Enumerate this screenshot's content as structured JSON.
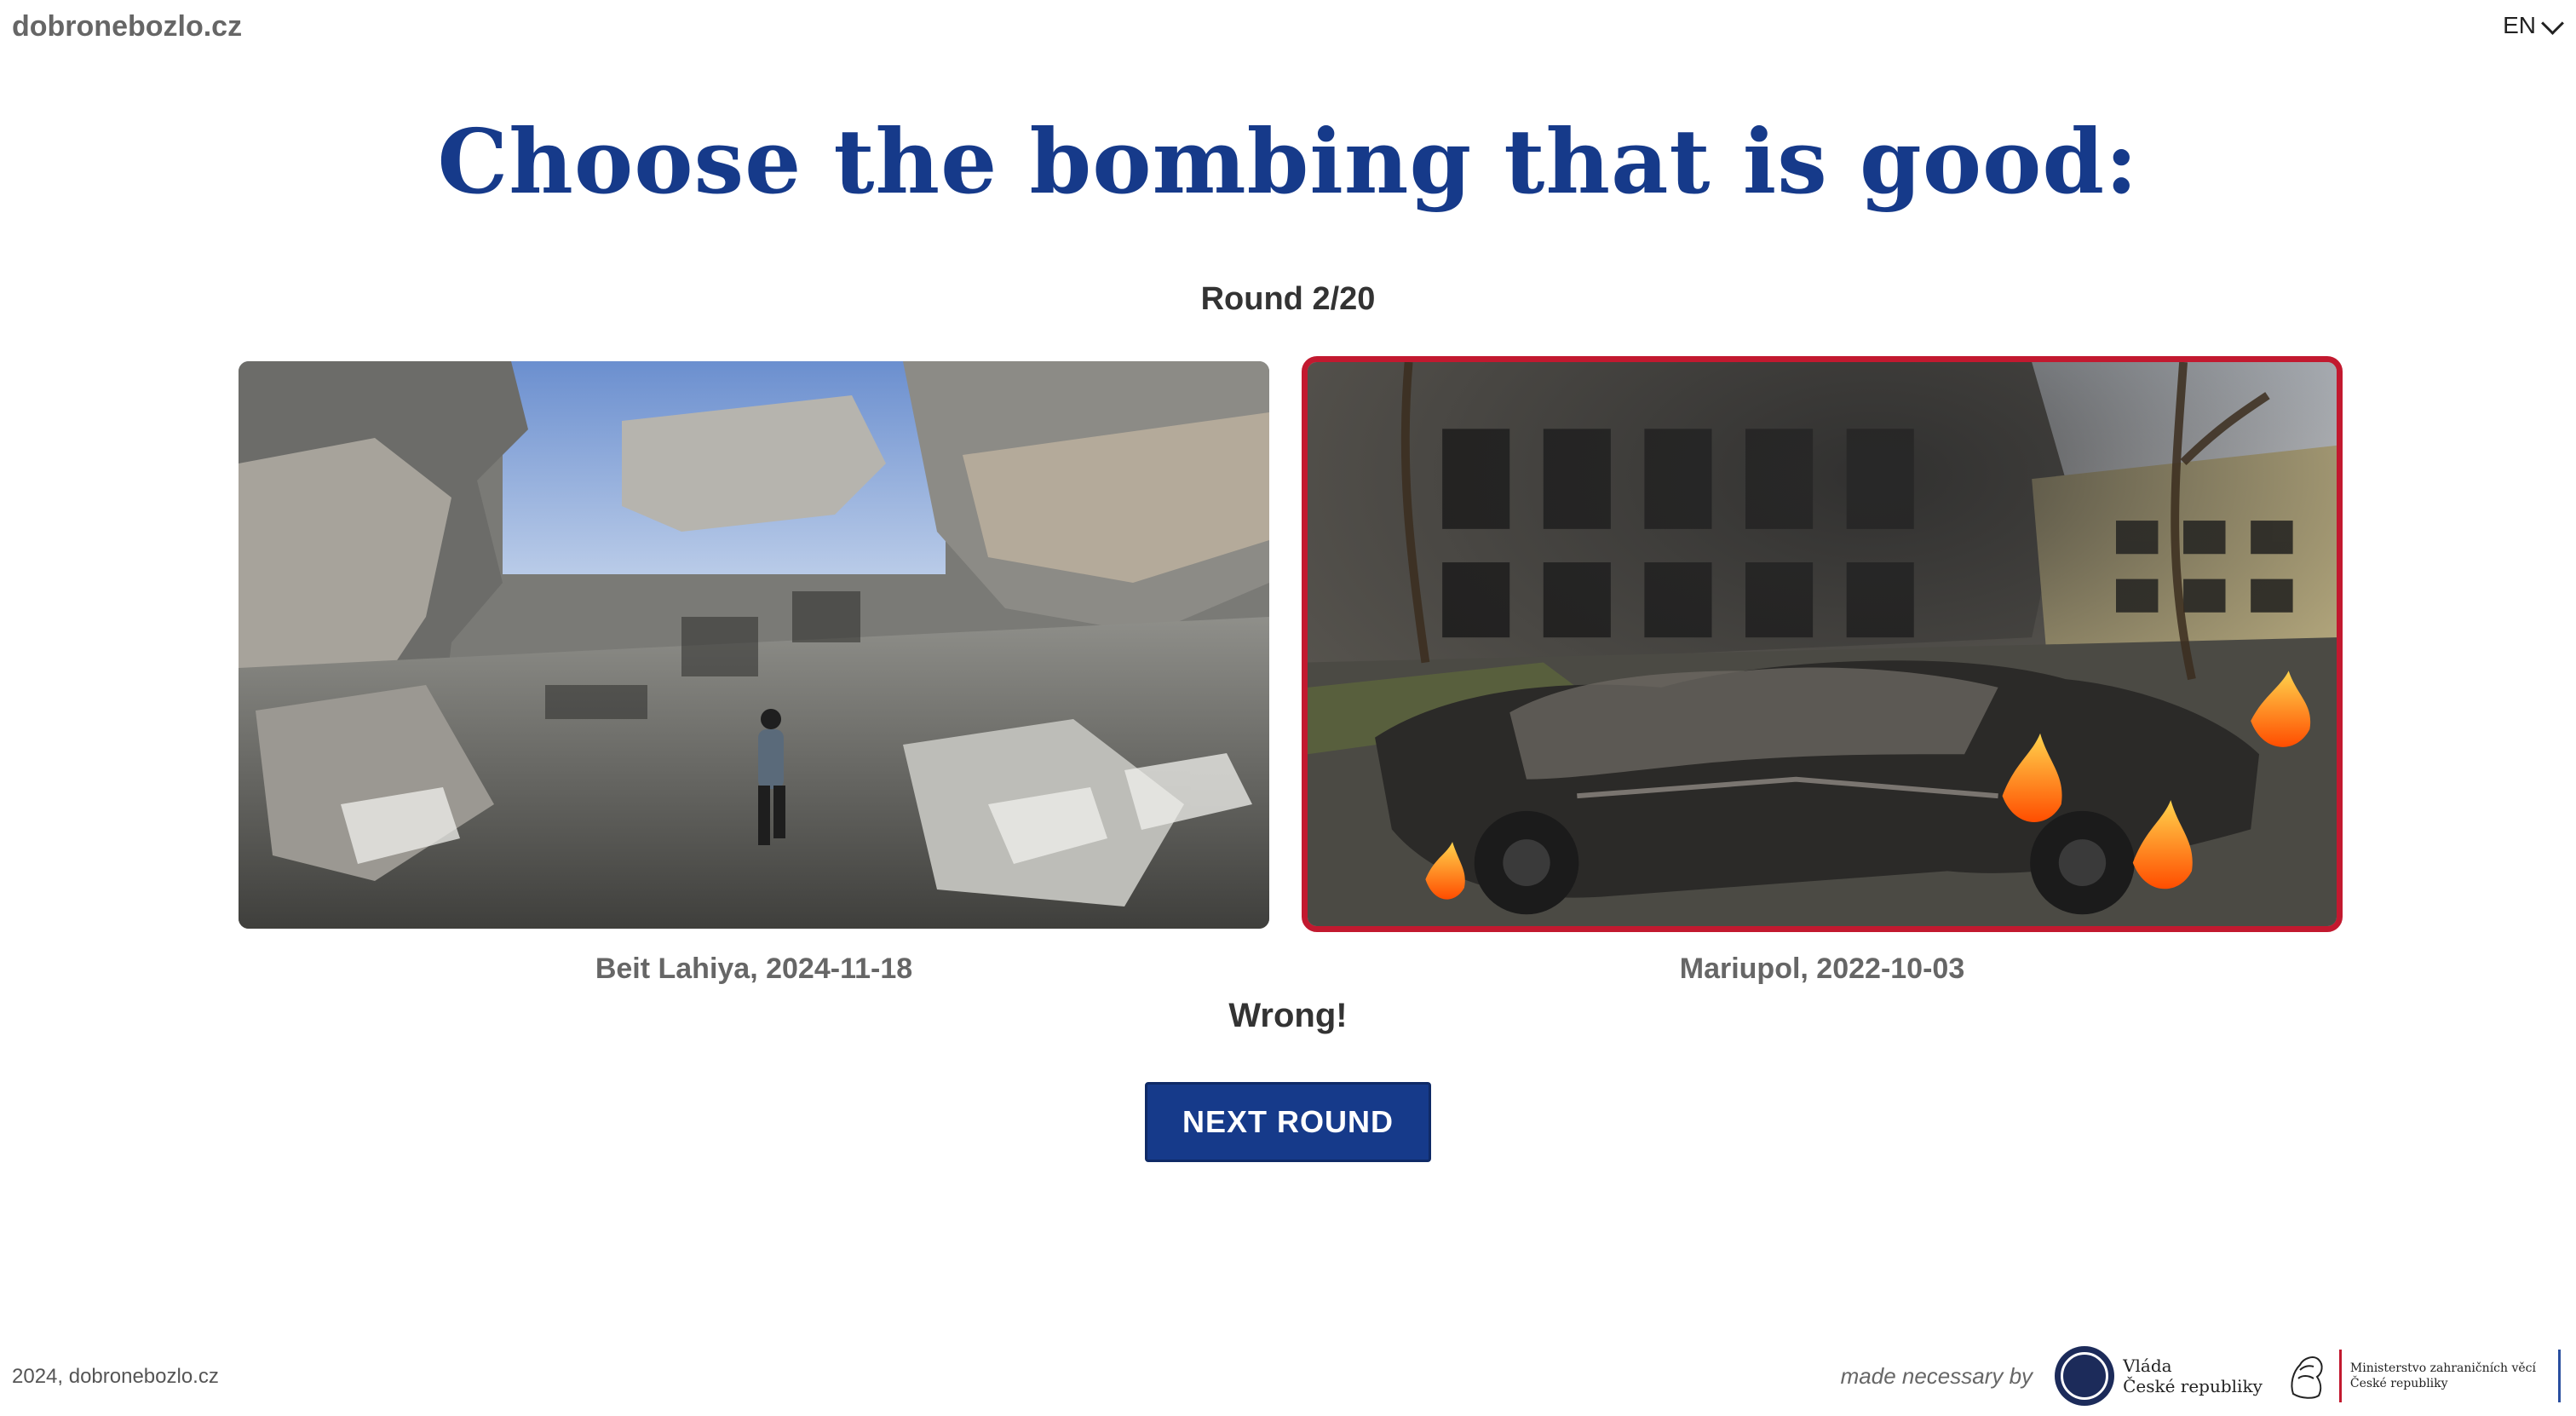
{
  "header": {
    "site_name": "dobronebozlo.cz",
    "language": "EN"
  },
  "main": {
    "title": "Choose the bombing that is good:",
    "round": "Round 2/20",
    "options": [
      {
        "caption": "Beit Lahiya, 2024-11-18",
        "selected": false
      },
      {
        "caption": "Mariupol, 2022-10-03",
        "selected": true
      }
    ],
    "result": "Wrong!",
    "next_button": "NEXT ROUND"
  },
  "footer": {
    "copyright": "2024, dobronebozlo.cz",
    "made_by": "made necessary by",
    "gov_logo_text": [
      "Vláda",
      "České republiky"
    ],
    "mzv_logo_text": [
      "Ministerstvo zahraničních věcí",
      "České republiky"
    ]
  },
  "colors": {
    "navy": "#163a8a",
    "selected_border": "#c2192f"
  }
}
